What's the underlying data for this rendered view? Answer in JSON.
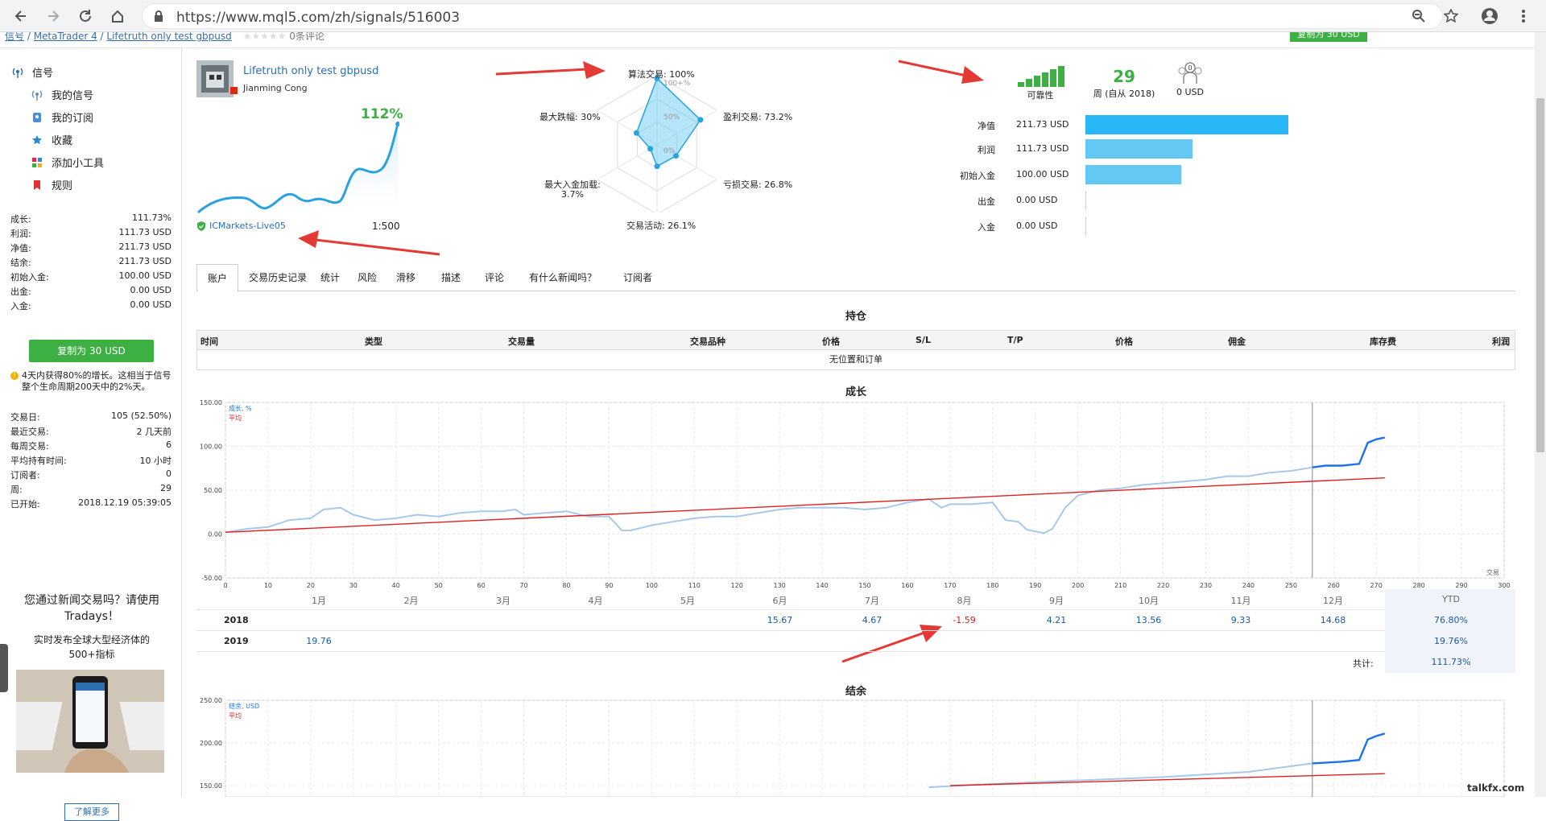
{
  "browser": {
    "url": "https://www.mql5.com/zh/signals/516003"
  },
  "topstrip": {
    "breadcrumb": [
      "信号",
      "MetaTrader 4",
      "Lifetruth only test gbpusd"
    ],
    "reviews": "0条评论",
    "copy_label": "复制为 30 USD"
  },
  "sidebar": {
    "signals_header": "信号",
    "items": [
      {
        "label": "我的信号",
        "icon": "antenna-icon"
      },
      {
        "label": "我的订阅",
        "icon": "subscription-icon"
      },
      {
        "label": "收藏",
        "icon": "star-icon"
      },
      {
        "label": "添加小工具",
        "icon": "widgets-icon"
      },
      {
        "label": "规则",
        "icon": "bookmark-icon"
      }
    ],
    "stats": [
      {
        "label": "成长:",
        "value": "111.73%"
      },
      {
        "label": "利润:",
        "value": "111.73 USD"
      },
      {
        "label": "净值:",
        "value": "211.73 USD"
      },
      {
        "label": "结余:",
        "value": "211.73 USD"
      },
      {
        "label": "初始入金:",
        "value": "100.00 USD"
      },
      {
        "label": "出金:",
        "value": "0.00 USD"
      },
      {
        "label": "入金:",
        "value": "0.00 USD"
      }
    ],
    "copy_button": "复制为 30 USD",
    "growth_note": "4天内获得80%的增长。这相当于信号整个生命周期200天中的2%天。",
    "stats2": [
      {
        "label": "交易日:",
        "value": "105 (52.50%)"
      },
      {
        "label": "最近交易:",
        "value": "2 几天前"
      },
      {
        "label": "每周交易:",
        "value": "6"
      },
      {
        "label": "平均持有时间:",
        "value": "10 小时"
      },
      {
        "label": "订阅者:",
        "value": "0"
      },
      {
        "label": "周:",
        "value": "29"
      },
      {
        "label": "已开始:",
        "value": "2018.12.19 05:39:05"
      }
    ],
    "ad_title": "您通过新闻交易吗？请使用Tradays！",
    "ad_subtitle": "实时发布全球大型经济体的500+指标",
    "learn_more": "了解更多"
  },
  "signal": {
    "title": "Lifetruth only test gbpusd",
    "author": "Jianming Cong",
    "growth": "112%",
    "broker": "ICMarkets-Live05",
    "leverage": "1:500"
  },
  "radar": {
    "labels": {
      "algo": "算法交易: 100%",
      "profit_trades": "盈利交易: 73.2%",
      "loss_trades": "亏损交易: 26.8%",
      "activity": "交易活动: 26.1%",
      "max_deposit_load": "最大入金加载:",
      "max_deposit_load_value": "3.7%",
      "max_drawdown": "最大跌幅: 30%"
    },
    "rings": [
      "100+%",
      "50%",
      "0%"
    ],
    "values": [
      100,
      73.2,
      26.8,
      26.1,
      3.7,
      30
    ]
  },
  "reliability": {
    "label": "可靠性",
    "weeks": "29",
    "weeks_label": "周 (自从 2018)",
    "subscribers_icon_value": "0",
    "subscribers_usd": "0 USD"
  },
  "summary_bars": [
    {
      "label": "净值",
      "value": "211.73 USD",
      "amount": 211.73,
      "color": "#29b6f6"
    },
    {
      "label": "利润",
      "value": "111.73 USD",
      "amount": 111.73,
      "color": "#64c8f4"
    },
    {
      "label": "初始入金",
      "value": "100.00 USD",
      "amount": 100.0,
      "color": "#64c8f4"
    },
    {
      "label": "出金",
      "value": "0.00 USD",
      "amount": 0,
      "color": "#64c8f4"
    },
    {
      "label": "入金",
      "value": "0.00 USD",
      "amount": 0,
      "color": "#64c8f4"
    }
  ],
  "tabs": [
    "账户",
    "交易历史记录",
    "统计",
    "风险",
    "滑移",
    "描述",
    "评论",
    "有什么新闻吗？",
    "订阅者"
  ],
  "positions": {
    "title": "持仓",
    "columns": [
      "时间",
      "类型",
      "交易量",
      "交易品种",
      "价格",
      "S/L",
      "T/P",
      "价格",
      "佣金",
      "库存费",
      "利润"
    ],
    "empty": "无位置和订单"
  },
  "chart_data": [
    {
      "type": "line",
      "title": "成长",
      "legend": [
        "成长, %",
        "平均"
      ],
      "xlabel": "交易",
      "xlim": [
        0,
        300
      ],
      "ylim": [
        -50,
        150
      ],
      "x_ticks": [
        0,
        10,
        20,
        30,
        40,
        50,
        60,
        70,
        80,
        90,
        100,
        110,
        120,
        130,
        140,
        150,
        160,
        170,
        180,
        190,
        200,
        210,
        220,
        230,
        240,
        250,
        260,
        270,
        280,
        290,
        300
      ],
      "y_ticks": [
        "150.00",
        "100.00",
        "50.00",
        "0.00",
        "-50.00"
      ],
      "series": [
        {
          "name": "成长, %",
          "color": "#a8c8e8",
          "x": [
            0,
            5,
            10,
            15,
            20,
            23,
            27,
            30,
            35,
            40,
            45,
            50,
            55,
            60,
            65,
            68,
            70,
            75,
            80,
            85,
            90,
            93,
            95,
            100,
            105,
            110,
            115,
            120,
            125,
            130,
            135,
            140,
            145,
            150,
            155,
            160,
            165,
            168,
            170,
            175,
            180,
            183,
            186,
            188,
            190,
            192,
            194,
            197,
            200,
            205,
            210,
            215,
            220,
            225,
            230,
            235,
            240,
            245,
            250,
            255
          ],
          "y": [
            2,
            6,
            8,
            16,
            18,
            28,
            30,
            22,
            16,
            18,
            22,
            20,
            24,
            26,
            26,
            28,
            22,
            24,
            26,
            20,
            20,
            4,
            4,
            10,
            14,
            18,
            20,
            20,
            24,
            28,
            30,
            30,
            30,
            28,
            30,
            36,
            40,
            30,
            34,
            34,
            36,
            16,
            14,
            5,
            3,
            1,
            6,
            30,
            44,
            50,
            52,
            56,
            58,
            60,
            62,
            66,
            66,
            70,
            72,
            76
          ]
        },
        {
          "name": "成长, %",
          "color": "#1a73e8",
          "x": [
            255,
            258,
            262,
            266,
            268,
            270,
            272
          ],
          "y": [
            76,
            78,
            78,
            80,
            104,
            108,
            110
          ]
        },
        {
          "name": "平均",
          "color": "#e02020",
          "x": [
            0,
            272
          ],
          "y": [
            2,
            64
          ]
        }
      ]
    },
    {
      "type": "table",
      "months": [
        "1月",
        "2月",
        "3月",
        "4月",
        "5月",
        "6月",
        "7月",
        "8月",
        "9月",
        "10月",
        "11月",
        "12月",
        "YTD"
      ],
      "rows": [
        {
          "year": "2018",
          "values": [
            "",
            "",
            "",
            "",
            "",
            "15.67",
            "4.67",
            "-1.59",
            "4.21",
            "13.56",
            "9.33",
            "14.68"
          ],
          "ytd": "76.80%"
        },
        {
          "year": "2019",
          "values": [
            "19.76",
            "",
            "",
            "",
            "",
            "",
            "",
            "",
            "",
            "",
            "",
            ""
          ],
          "ytd": "19.76%"
        }
      ],
      "total_label": "共计:",
      "total": "111.73%"
    },
    {
      "type": "line",
      "title": "结余",
      "legend": [
        "结余, USD",
        "平均"
      ],
      "ylim": [
        150,
        250
      ],
      "y_ticks": [
        "250.00",
        "200.00",
        "150.00"
      ],
      "series": [
        {
          "name": "结余, USD",
          "color": "#a8c8e8",
          "x": [
            165,
            180,
            200,
            220,
            240,
            255
          ],
          "y": [
            148,
            152,
            156,
            160,
            166,
            176
          ]
        },
        {
          "name": "结余, USD",
          "color": "#1a73e8",
          "x": [
            255,
            262,
            266,
            268,
            270,
            272
          ],
          "y": [
            176,
            178,
            180,
            204,
            208,
            211
          ]
        },
        {
          "name": "平均",
          "color": "#e02020",
          "x": [
            170,
            272
          ],
          "y": [
            150,
            164
          ]
        }
      ]
    }
  ],
  "watermark": "talkfx.com"
}
